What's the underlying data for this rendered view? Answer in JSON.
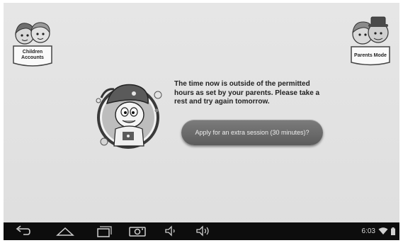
{
  "accounts": {
    "children_label_1": "Children",
    "children_label_2": "Accounts",
    "parents_label": "Parents Mode"
  },
  "message": {
    "line1": "The time now is outside of the permitted",
    "line2": "hours as set by your parents. Please take a",
    "line3": "rest and try again tomorrow."
  },
  "apply_button": {
    "label": "Apply for an extra session (30 minutes)?"
  },
  "statusbar": {
    "time": "6:03"
  },
  "nav": {
    "icons": [
      "back-icon",
      "home-icon",
      "recent-apps-icon",
      "screenshot-icon",
      "volume-down-icon",
      "volume-up-icon"
    ]
  },
  "colors": {
    "background": "#e2e2e2",
    "button": "#6a6a6a",
    "navbar": "#0d0d0d"
  }
}
